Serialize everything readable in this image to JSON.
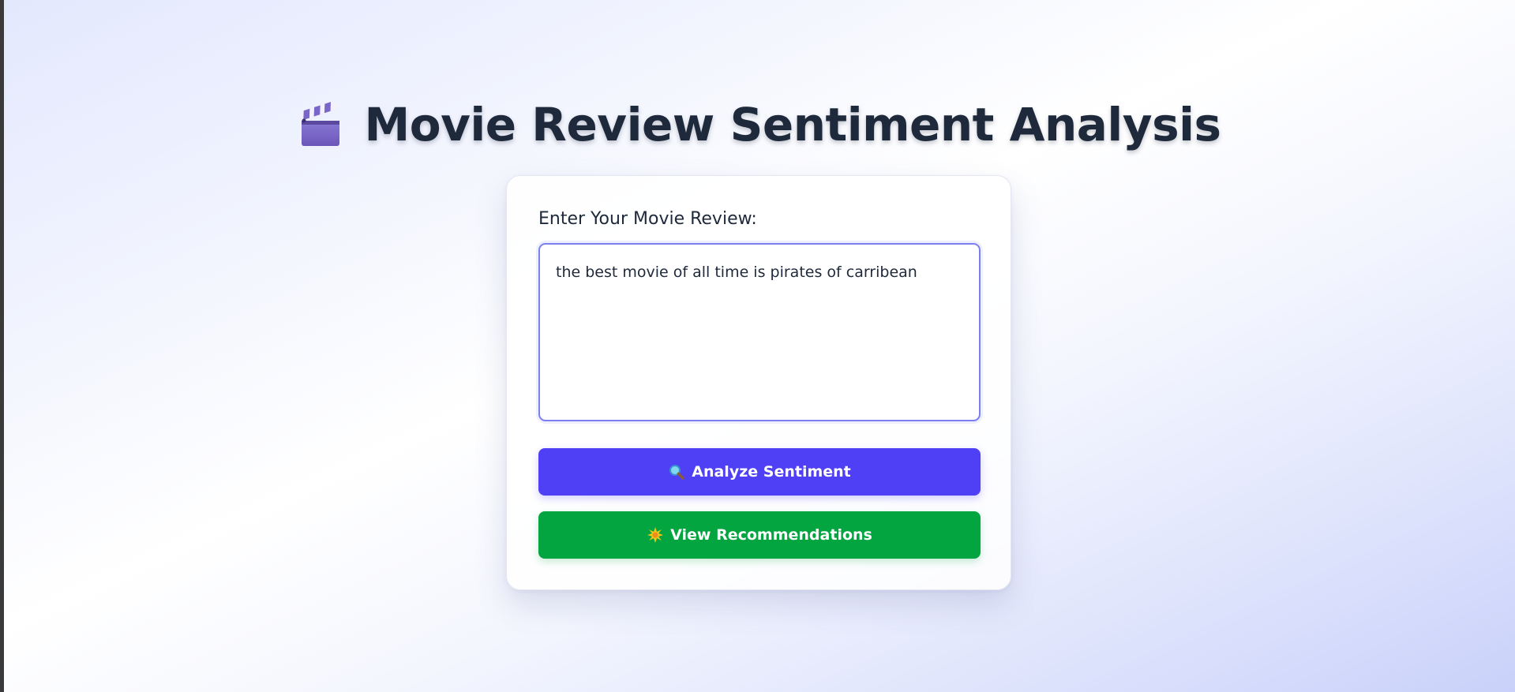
{
  "page": {
    "title": "Movie Review Sentiment Analysis",
    "title_icon": "clapperboard-icon"
  },
  "form": {
    "label": "Enter Your Movie Review:",
    "review_value": "the best movie of all time is pirates of carribean"
  },
  "buttons": {
    "analyze_label": "Analyze Sentiment",
    "analyze_icon": "magnifying-glass-icon",
    "recommend_label": "View Recommendations",
    "recommend_icon": "sparkle-icon"
  },
  "colors": {
    "title": "#1e293b",
    "analyze_button": "#4f3ff5",
    "recommend_button": "#02a540",
    "input_border": "#7b7ff0"
  }
}
